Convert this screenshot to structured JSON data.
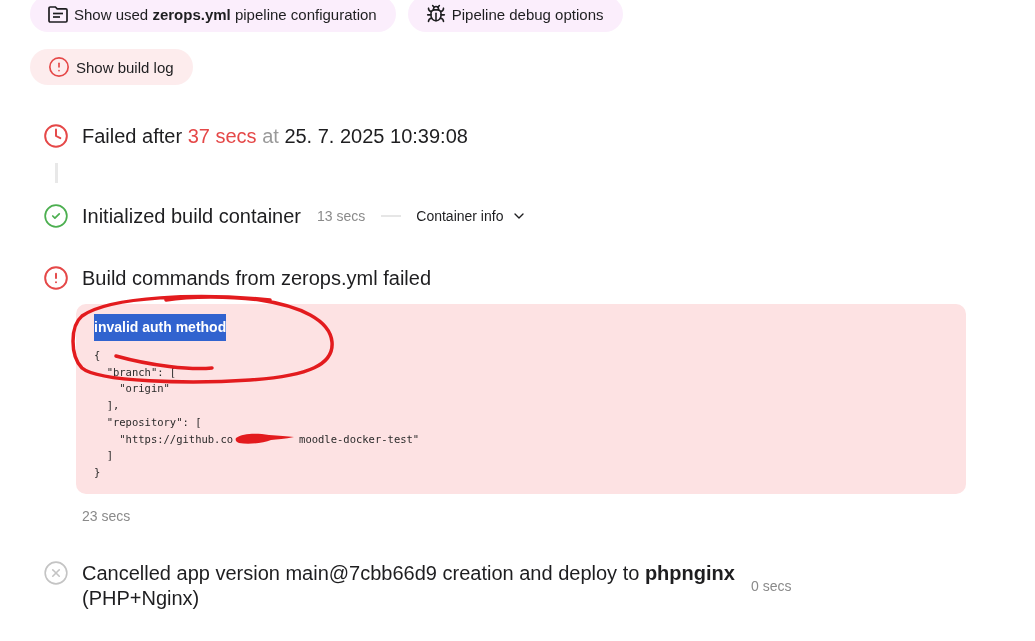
{
  "actions": [
    {
      "kind": "config",
      "label": "Show used **zerops.yml** pipeline configuration"
    },
    {
      "kind": "debug",
      "label": "Pipeline debug options"
    },
    {
      "kind": "log",
      "label": "Show build log"
    }
  ],
  "summary": {
    "prefix": "Failed after",
    "duration": "37 secs",
    "connector": "at",
    "timestamp": "25. 7. 2025 10:39:08"
  },
  "steps": [
    {
      "kind": "success",
      "title": "Initialized build container",
      "duration": "13 secs",
      "details": {
        "label": "Container info",
        "expanded": false
      }
    },
    {
      "kind": "failed",
      "title": "Build commands from zerops.yml failed",
      "error": {
        "message": "invalid auth method",
        "selected": true,
        "circled": true,
        "lines": [
          {
            "kind": "plain",
            "text": "{"
          },
          {
            "kind": "plain",
            "text": "  \"branch\": ["
          },
          {
            "kind": "plain",
            "text": "    \"origin\""
          },
          {
            "kind": "plain",
            "text": "  ],"
          },
          {
            "kind": "plain",
            "text": "  \"repository\": ["
          },
          {
            "kind": "redacted",
            "before": "    \"https://github.co",
            "after": "moodle-docker-test\""
          },
          {
            "kind": "plain",
            "text": "  ]"
          },
          {
            "kind": "plain",
            "text": "}"
          }
        ]
      },
      "duration": "23 secs"
    },
    {
      "kind": "cancelled",
      "title": "Cancelled app version main@7cbb66d9 creation and deploy to **phpnginx** (PHP+Nginx)",
      "duration": "0 secs"
    }
  ]
}
